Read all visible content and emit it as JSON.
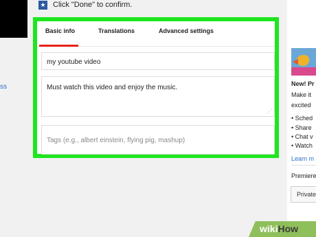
{
  "header": {
    "done_text": "Click \"Done\" to confirm."
  },
  "left": {
    "partial_link": "ss"
  },
  "tabs": [
    {
      "label": "Basic info"
    },
    {
      "label": "Translations"
    },
    {
      "label": "Advanced settings"
    }
  ],
  "form": {
    "title_value": "my youtube video",
    "description_value": "Must watch this video and enjoy the music.",
    "tags_placeholder": "Tags (e.g., albert einstein, flying pig, mashup)"
  },
  "sidebar": {
    "title": "New! Pr",
    "text_lines": [
      "Make it",
      "excited"
    ],
    "bullets": [
      "• Sched",
      "• Share",
      "• Chat v",
      "• Watch"
    ],
    "learn_more": "Learn m",
    "premiere_label": "Premiere",
    "private_button": "Private"
  },
  "watermark": {
    "wiki": "wiki",
    "how": "How"
  },
  "colors": {
    "highlight_border": "#1ee61e",
    "tab_underline": "#e62117",
    "link": "#2a6fc9"
  }
}
